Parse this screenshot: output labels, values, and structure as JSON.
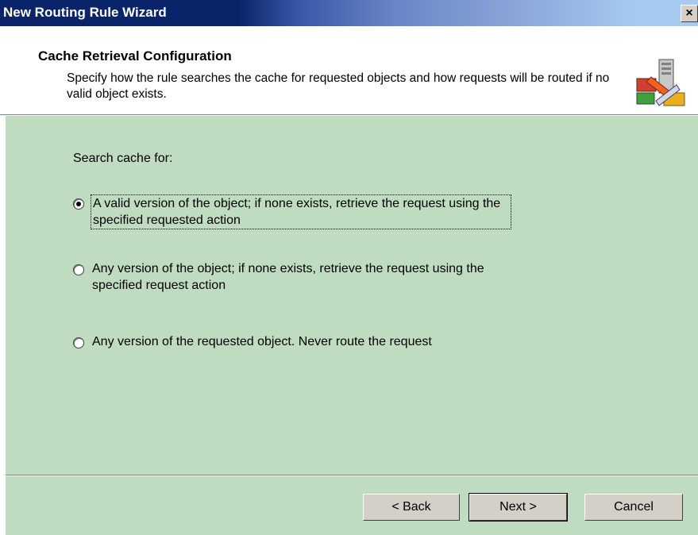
{
  "window": {
    "title": "New Routing Rule Wizard",
    "close_glyph": "×"
  },
  "header": {
    "title": "Cache Retrieval Configuration",
    "description": "Specify how the rule searches the cache for requested objects and how requests will be routed if no valid object exists.",
    "icon": "routing-server-icon"
  },
  "content": {
    "search_label": "Search cache for:",
    "options": [
      {
        "label": "A valid version of the object; if none exists, retrieve the request using the specified requested action",
        "selected": true
      },
      {
        "label": "Any version of the object; if none exists, retrieve the request using the specified request action",
        "selected": false
      },
      {
        "label": "Any version of the requested object. Never route the request",
        "selected": false
      }
    ]
  },
  "buttons": {
    "back": "< Back",
    "next": "Next >",
    "cancel": "Cancel"
  },
  "colors": {
    "body_background": "#c0dcc0",
    "titlebar": "#0a246a",
    "button_face": "#d4d0c8"
  }
}
